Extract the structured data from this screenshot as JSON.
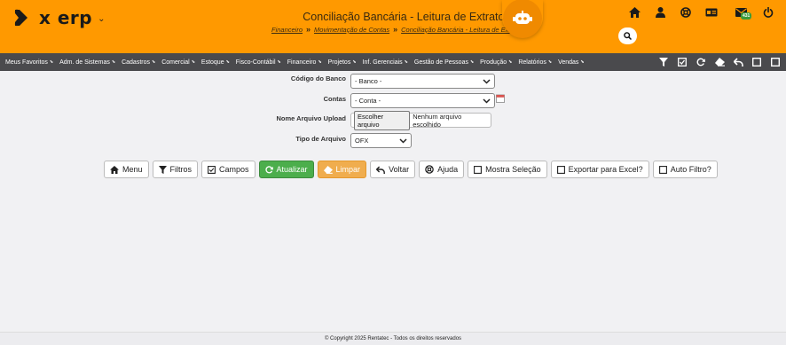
{
  "app": {
    "logo_text": "x erp"
  },
  "header": {
    "title": "Conciliação Bancária - Leitura de Extratos",
    "breadcrumbs": [
      "Financeiro",
      "Movimentação de Contas",
      "Conciliação Bancária - Leitura de Extrato"
    ],
    "mail_badge": "431"
  },
  "menu": [
    "Meus Favoritos",
    "Adm. de Sistemas",
    "Cadastros",
    "Comercial",
    "Estoque",
    "Fisco-Contábil",
    "Financeiro",
    "Projetos",
    "Inf. Gerenciais",
    "Gestão de Pessoas",
    "Produção",
    "Relatórios",
    "Vendas"
  ],
  "form": {
    "banco": {
      "label": "Código do Banco",
      "value": "- Banco -"
    },
    "contas": {
      "label": "Contas",
      "value": "- Conta -"
    },
    "arquivo": {
      "label": "Nome Arquivo Upload",
      "button": "Escolher arquivo",
      "status": "Nenhum arquivo escolhido"
    },
    "tipo": {
      "label": "Tipo de Arquivo",
      "value": "OFX"
    }
  },
  "buttons": {
    "menu": "Menu",
    "filtros": "Filtros",
    "campos": "Campos",
    "atualizar": "Atualizar",
    "limpar": "Limpar",
    "voltar": "Voltar",
    "ajuda": "Ajuda",
    "mostra_selecao": "Mostra Seleção",
    "exportar_excel": "Exportar para Excel?",
    "auto_filtro": "Auto Filtro?"
  },
  "footer": "© Copyright 2025 Rentatec - Todos os direitos reservados",
  "colors": {
    "header": "#ff9900",
    "menubar": "#4a4a4d",
    "green": "#4cae4c",
    "orange": "#f0ad4e"
  }
}
